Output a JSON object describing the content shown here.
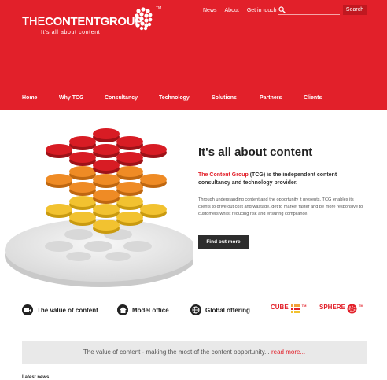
{
  "header": {
    "logo": {
      "name_thin": "THE",
      "name_bold": "CONTENTGROUP",
      "tagline": "It's all about content",
      "tm": "TM"
    },
    "top_nav": [
      "News",
      "About",
      "Get in touch"
    ],
    "search": {
      "placeholder": "",
      "button_label": "Search"
    },
    "main_nav": [
      "Home",
      "Why TCG",
      "Consultancy",
      "Technology",
      "Solutions",
      "Partners",
      "Clients"
    ],
    "active_nav": "Home"
  },
  "hero": {
    "title": "It's all about content",
    "lead_brand": "The Content Group",
    "lead_rest": " (TCG) is the independent content consultancy and technology provider.",
    "body": "Through understanding content and the opportunity it presents, TCG enables its clients to drive out cost and wastage, get to market faster and be more responsive to customers whilst reducing risk and ensuring compliance.",
    "cta_label": "Find out more"
  },
  "features": [
    {
      "label": "The value of content",
      "icon": "video-icon"
    },
    {
      "label": "Model office",
      "icon": "home-icon"
    },
    {
      "label": "Global offering",
      "icon": "globe-icon"
    }
  ],
  "brands": [
    {
      "label": "CUBE",
      "tm": "TM"
    },
    {
      "label": "SPHERE",
      "tm": "TM"
    }
  ],
  "banner": {
    "text": "The value of content - making the most of the content opportunity...",
    "link": "read more..."
  },
  "news_heading": "Latest news",
  "colors": {
    "brand_red": "#e2202a",
    "dark": "#2d2d2d",
    "banner_bg": "#e9e9e9"
  }
}
